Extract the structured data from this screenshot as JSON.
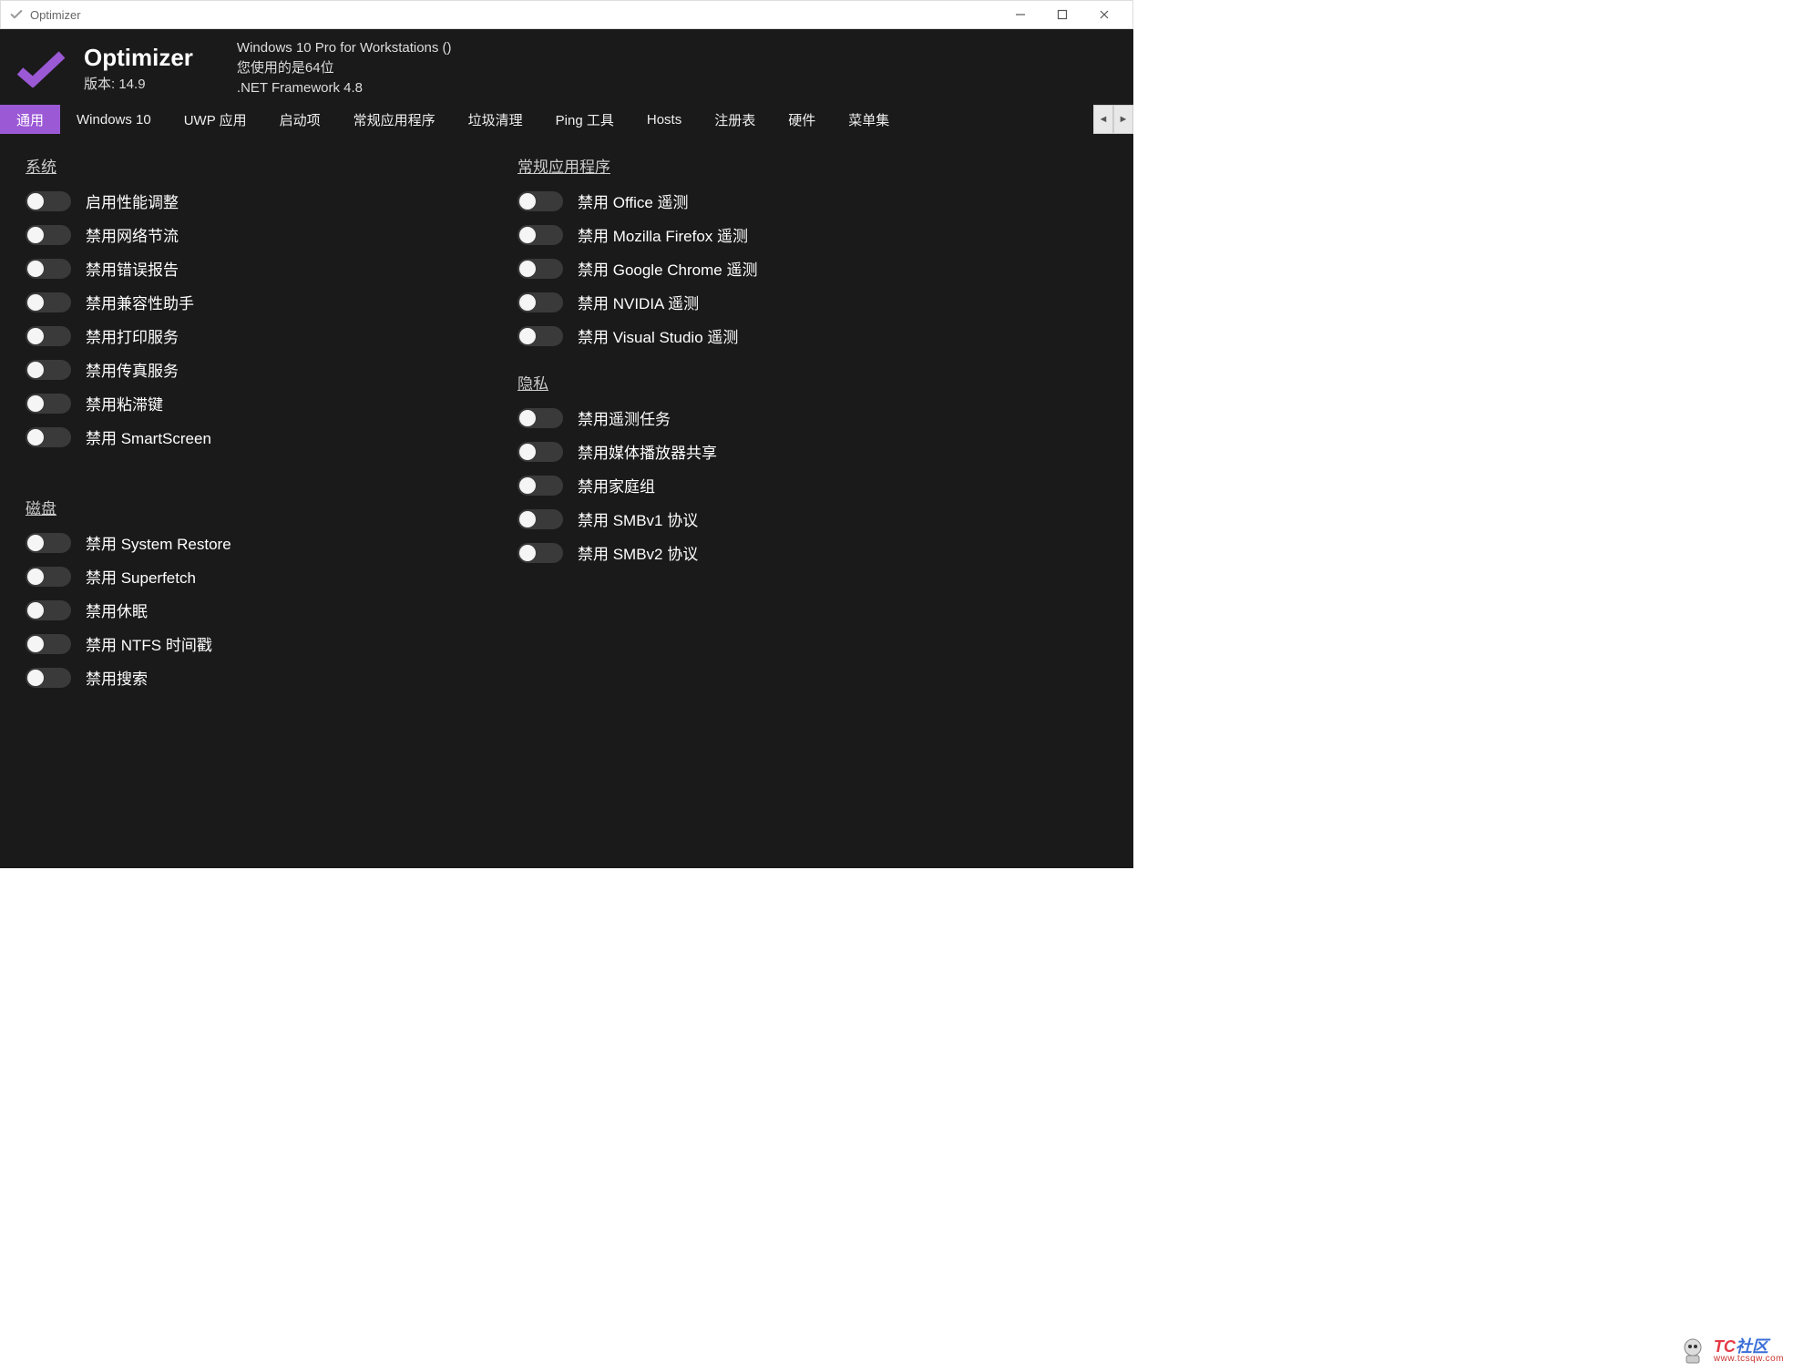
{
  "titlebar": {
    "title": "Optimizer"
  },
  "header": {
    "app_name": "Optimizer",
    "version_label": "版本:",
    "version": "14.9",
    "os": "Windows 10 Pro for Workstations ()",
    "arch": "您使用的是64位",
    "framework": ".NET Framework 4.8"
  },
  "tabs": {
    "items": [
      {
        "label": "通用",
        "active": true
      },
      {
        "label": "Windows 10",
        "active": false
      },
      {
        "label": "UWP 应用",
        "active": false
      },
      {
        "label": "启动项",
        "active": false
      },
      {
        "label": "常规应用程序",
        "active": false
      },
      {
        "label": "垃圾清理",
        "active": false
      },
      {
        "label": "Ping 工具",
        "active": false
      },
      {
        "label": "Hosts",
        "active": false
      },
      {
        "label": "注册表",
        "active": false
      },
      {
        "label": "硬件",
        "active": false
      },
      {
        "label": "菜单集",
        "active": false
      }
    ]
  },
  "sections": {
    "system": {
      "title": "系统",
      "items": [
        "启用性能调整",
        "禁用网络节流",
        "禁用错误报告",
        "禁用兼容性助手",
        "禁用打印服务",
        "禁用传真服务",
        "禁用粘滞键",
        "禁用 SmartScreen"
      ]
    },
    "disk": {
      "title": "磁盘",
      "items": [
        "禁用 System Restore",
        "禁用 Superfetch",
        "禁用休眠",
        "禁用 NTFS 时间戳",
        "禁用搜索"
      ]
    },
    "apps": {
      "title": "常规应用程序",
      "items": [
        "禁用 Office 遥测",
        "禁用 Mozilla Firefox 遥测",
        "禁用 Google Chrome 遥测",
        "禁用 NVIDIA 遥测",
        "禁用 Visual Studio 遥测"
      ]
    },
    "privacy": {
      "title": "隐私",
      "items": [
        "禁用遥测任务",
        "禁用媒体播放器共享",
        "禁用家庭组",
        "禁用 SMBv1 协议",
        "禁用 SMBv2 协议"
      ]
    }
  },
  "watermark": {
    "line1a": "T",
    "line1b": "C",
    "line1c": "社区",
    "line2": "www.tcsqw.com"
  },
  "colors": {
    "accent": "#9b59d6",
    "bg": "#1a1a1a"
  }
}
